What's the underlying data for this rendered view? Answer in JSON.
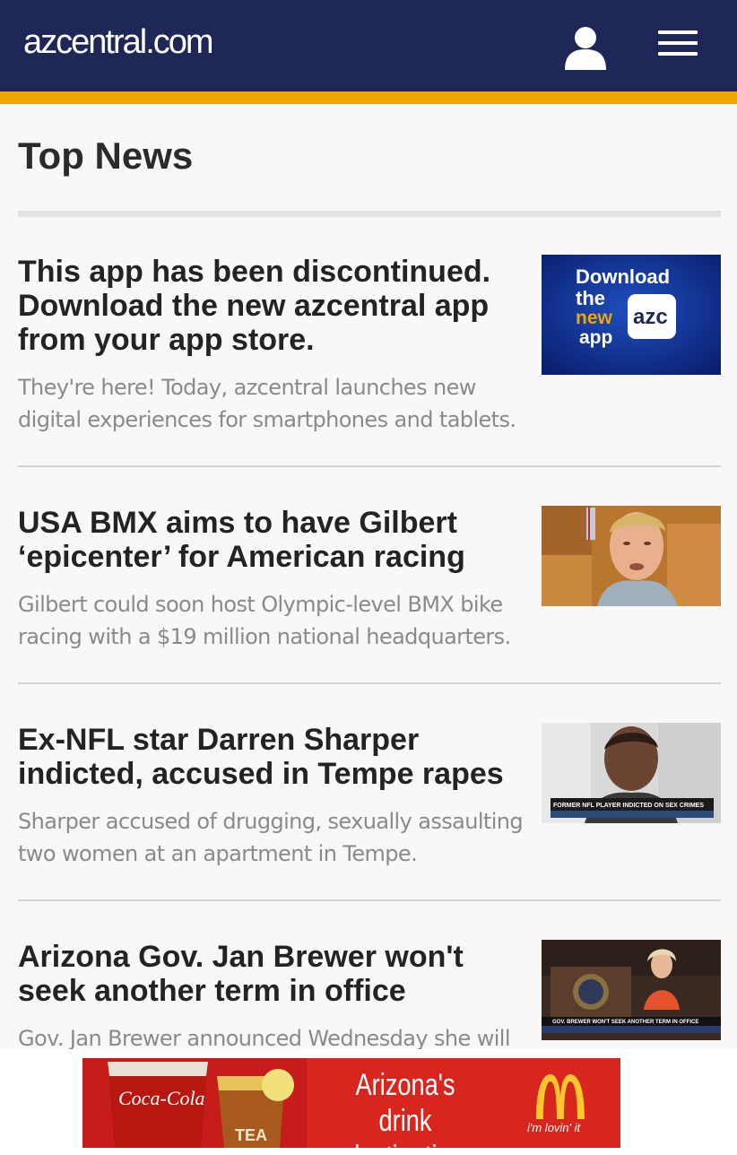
{
  "header": {
    "logo_text": "azcentral.com",
    "bg_color": "#1f2757",
    "accent_color": "#f0a500",
    "user_icon": "user-icon",
    "menu_icon": "hamburger-menu-icon"
  },
  "page": {
    "title": "Top News"
  },
  "stories": [
    {
      "headline": "This app has been discontinued. Download the new azcentral app from your app store.",
      "summary": "They're here! Today, azcentral launches new digital experiences for smartphones and tablets.",
      "thumb_text": [
        "Download",
        "the",
        "new",
        "app"
      ],
      "thumb_badge": "azc"
    },
    {
      "headline": "USA BMX aims to have Gilbert ‘epicenter’ for American racing",
      "summary": "Gilbert could soon host Olympic-level BMX bike racing with a $19 million national headquarters."
    },
    {
      "headline": "Ex-NFL star Darren Sharper indicted, accused in Tempe rapes",
      "summary": "Sharper accused of drugging, sexually assaulting two women at an apartment in Tempe.",
      "thumb_caption": "FORMER NFL PLAYER INDICTED ON SEX CRIMES"
    },
    {
      "headline": "Arizona Gov. Jan Brewer won't seek another term in office",
      "summary": "Gov. Jan Brewer announced Wednesday she will not",
      "thumb_caption": "GOV. BREWER WON'T SEEK ANOTHER TERM IN OFFICE"
    }
  ],
  "ad": {
    "brand_script": "Coca-Cola",
    "tea_label": "TEA",
    "headline_1": "Arizona's",
    "headline_2": "drink destination",
    "tagline": "i'm lovin' it",
    "bg_color": "#d7261e"
  }
}
